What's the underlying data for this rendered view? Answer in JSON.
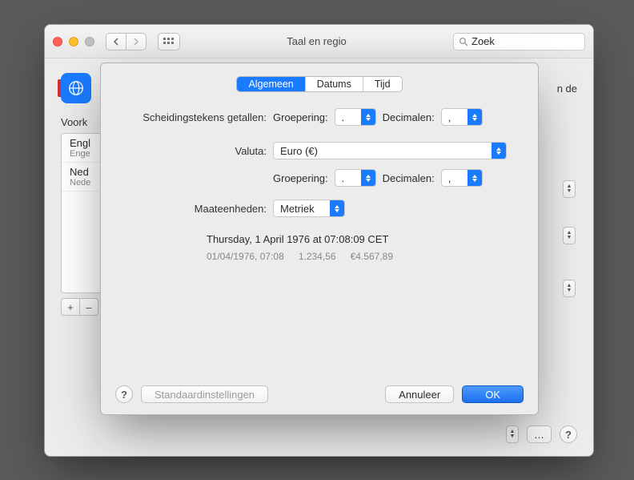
{
  "window": {
    "title": "Taal en regio",
    "search_placeholder": "Zoek",
    "header_tail": "n de",
    "voork_label": "Voork",
    "list": [
      {
        "title": "Engl",
        "sub": "Enge"
      },
      {
        "title": "Ned",
        "sub": "Nede"
      }
    ],
    "add": "+",
    "rem": "–",
    "ellipsis": "…"
  },
  "sheet": {
    "tabs": {
      "general": "Algemeen",
      "dates": "Datums",
      "time": "Tijd"
    },
    "labels": {
      "num_sep": "Scheidingstekens getallen:",
      "group": "Groepering:",
      "dec": "Decimalen:",
      "currency": "Valuta:",
      "units": "Maateenheden:"
    },
    "values": {
      "group1": ".",
      "dec1": ",",
      "currency": "Euro (€)",
      "group2": ".",
      "dec2": ",",
      "units": "Metriek"
    },
    "preview": {
      "line1": "Thursday, 1 April 1976 at 07:08:09 CET",
      "line2_a": "01/04/1976, 07:08",
      "line2_b": "1.234,56",
      "line2_c": "€4.567,89"
    },
    "buttons": {
      "defaults": "Standaardinstellingen",
      "cancel": "Annuleer",
      "ok": "OK"
    }
  }
}
